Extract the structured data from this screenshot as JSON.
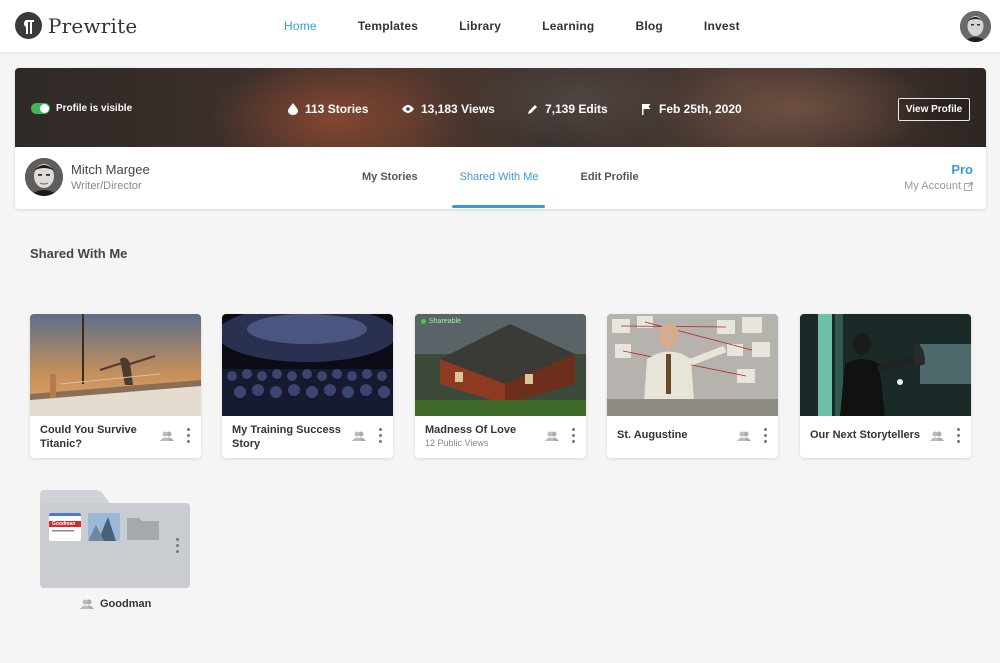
{
  "brand": {
    "name": "Prewrite"
  },
  "nav": {
    "items": [
      {
        "label": "Home",
        "active": true
      },
      {
        "label": "Templates",
        "active": false
      },
      {
        "label": "Library",
        "active": false
      },
      {
        "label": "Learning",
        "active": false
      },
      {
        "label": "Blog",
        "active": false
      },
      {
        "label": "Invest",
        "active": false
      }
    ]
  },
  "profile": {
    "visibility_label": "Profile is visible",
    "visibility_on": true,
    "stats": {
      "stories": "113 Stories",
      "views": "13,183 Views",
      "edits": "7,139 Edits",
      "date": "Feb 25th, 2020"
    },
    "view_profile_label": "View Profile",
    "name": "Mitch Margee",
    "role": "Writer/Director",
    "tabs": [
      {
        "label": "My Stories",
        "active": false
      },
      {
        "label": "Shared With Me",
        "active": true
      },
      {
        "label": "Edit Profile",
        "active": false
      }
    ],
    "plan": "Pro",
    "account_link": "My Account"
  },
  "section": {
    "title": "Shared With Me"
  },
  "stories": [
    {
      "title": "Could You Survive Titanic?",
      "subtitle": ""
    },
    {
      "title": "My Training Success Story",
      "subtitle": ""
    },
    {
      "title": "Madness Of Love",
      "subtitle": "12 Public Views",
      "badge": "Shareable"
    },
    {
      "title": "St. Augustine",
      "subtitle": ""
    },
    {
      "title": "Our Next Storytellers",
      "subtitle": ""
    }
  ],
  "folder": {
    "name": "Goodman",
    "thumb_text": "Goodman"
  },
  "colors": {
    "accent": "#3a9ad9",
    "toggle_on": "#3db55a",
    "background": "#f5f5f5"
  }
}
